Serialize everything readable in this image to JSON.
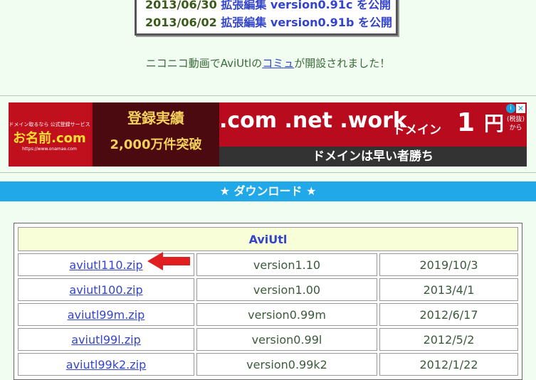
{
  "news": [
    {
      "date": "2013/06/30",
      "text": "拡張編集 version0.91c を公開"
    },
    {
      "date": "2013/06/02",
      "text": "拡張編集 version0.91b を公開"
    }
  ],
  "community": {
    "before": "ニコニコ動画でAviUtlの",
    "link": "コミュ",
    "after": "が開設されました！"
  },
  "ad": {
    "logo_small": "ドメイン取るなら 公式登録サービス",
    "logo_big": "お名前.com",
    "logo_url": "https://www.onamae.com",
    "mid_a": "登録実績",
    "mid_b": "2,000万件突破",
    "tlds": ".com .net .work",
    "domain": "ドメイン",
    "price": "1",
    "yen": "円",
    "tax": "(税抜)",
    "kara": "から",
    "bar": "ドメインは早い者勝ち",
    "info_icon": "i",
    "close_icon": "✕",
    "colors": {
      "bg": "#b80c1e",
      "accent": "#f5d05a"
    }
  },
  "download": {
    "header": "★ ダウンロード ★",
    "table_title": "AviUtl",
    "rows": [
      {
        "file": "aviutl110.zip",
        "version": "version1.10",
        "date": "2019/10/3"
      },
      {
        "file": "aviutl100.zip",
        "version": "version1.00",
        "date": "2013/4/1"
      },
      {
        "file": "aviutl99m.zip",
        "version": "version0.99m",
        "date": "2012/6/17"
      },
      {
        "file": "aviutl99l.zip",
        "version": "version0.99l",
        "date": "2012/5/2"
      },
      {
        "file": "aviutl99k2.zip",
        "version": "version0.99k2",
        "date": "2012/1/22"
      }
    ],
    "header_color": "#21a8e8",
    "arrow_color": "#e02020"
  }
}
